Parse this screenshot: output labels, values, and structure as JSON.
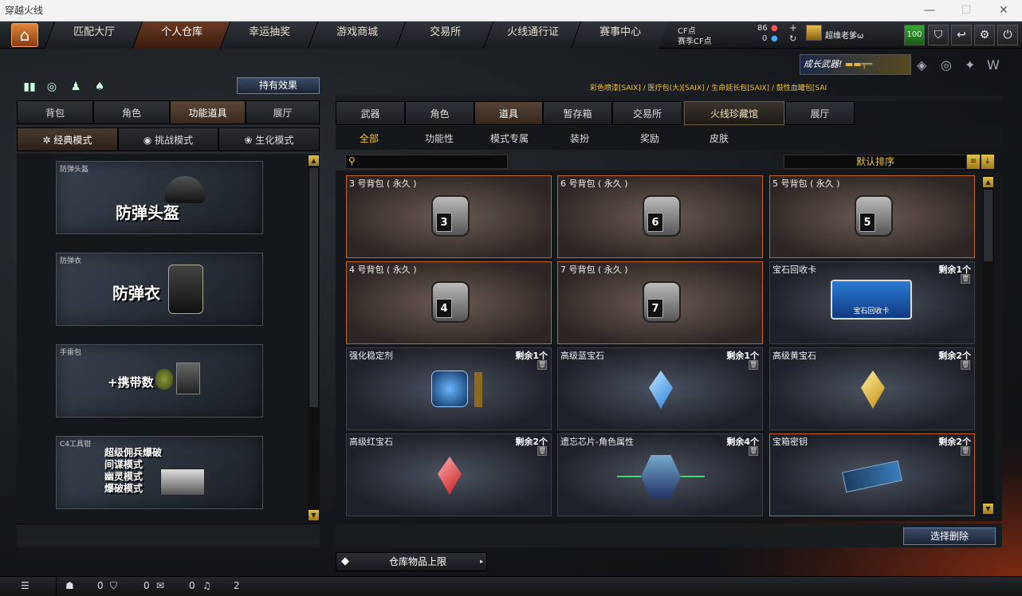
{
  "window": {
    "title": "穿越火线"
  },
  "nav": {
    "tabs": [
      "匹配大厅",
      "个人仓库",
      "幸运抽奖",
      "游戏商城",
      "交易所",
      "火线通行证",
      "赛事中心"
    ],
    "active": 1
  },
  "currency": {
    "cf_label": "CF点",
    "cf_value": "86",
    "season_label": "赛季CF点",
    "season_value": "0"
  },
  "player": {
    "name": "超维老爹ω",
    "level": "100"
  },
  "banner": {
    "text": "成长武器!"
  },
  "ticker": "彩色喷漆[SAIX] / 医疗包(大)[SAIX] / 生命延长包[SAIX] / 鼓性血罐包[SAI",
  "left": {
    "effect_button": "持有效果",
    "tabs": [
      "背包",
      "角色",
      "功能道具",
      "展厅"
    ],
    "mode_tabs": [
      "经典模式",
      "挑战模式",
      "生化模式"
    ],
    "cards": [
      {
        "caption": "防弹头盔",
        "title": "防弹头盔"
      },
      {
        "caption": "防弹衣",
        "title": "防弹衣"
      },
      {
        "caption": "手雷包",
        "title": "+携带数"
      },
      {
        "caption": "C4工具钳",
        "lines": [
          "超级佣兵爆破",
          "间谍模式",
          "幽灵模式",
          "爆破模式"
        ]
      }
    ]
  },
  "right": {
    "tabs": [
      "武器",
      "角色",
      "道具",
      "暂存箱",
      "交易所",
      "火线珍藏馆",
      "展厅"
    ],
    "subtabs": [
      "全部",
      "功能性",
      "模式专属",
      "装扮",
      "奖励",
      "皮肤"
    ],
    "sort_label": "默认排序",
    "items": [
      {
        "name": "3 号背包 ( 永久 )",
        "bag": "3"
      },
      {
        "name": "6 号背包 ( 永久 )",
        "bag": "6"
      },
      {
        "name": "5 号背包 ( 永久 )",
        "bag": "5"
      },
      {
        "name": "4 号背包 ( 永久 )",
        "bag": "4"
      },
      {
        "name": "7 号背包 ( 永久 )",
        "bag": "7"
      },
      {
        "name": "宝石回收卡",
        "qty": "剩余1个",
        "img_text": "宝石回收卡"
      },
      {
        "name": "强化稳定剂",
        "qty": "剩余1个"
      },
      {
        "name": "高级蓝宝石",
        "qty": "剩余1个"
      },
      {
        "name": "高级黄宝石",
        "qty": "剩余2个"
      },
      {
        "name": "高级红宝石",
        "qty": "剩余2个"
      },
      {
        "name": "遗忘芯片-角色属性",
        "qty": "剩余4个"
      },
      {
        "name": "宝箱密钥",
        "qty": "剩余2个"
      }
    ],
    "delete_button": "选择删除",
    "warehouse_label": "仓库物品上限"
  },
  "status": {
    "friends": "0",
    "clan": "0",
    "chat": "0",
    "volume": "2"
  },
  "colors": {
    "accent": "#f3c13d",
    "active_tab": "#574337",
    "bag_border": "#c7632a"
  }
}
